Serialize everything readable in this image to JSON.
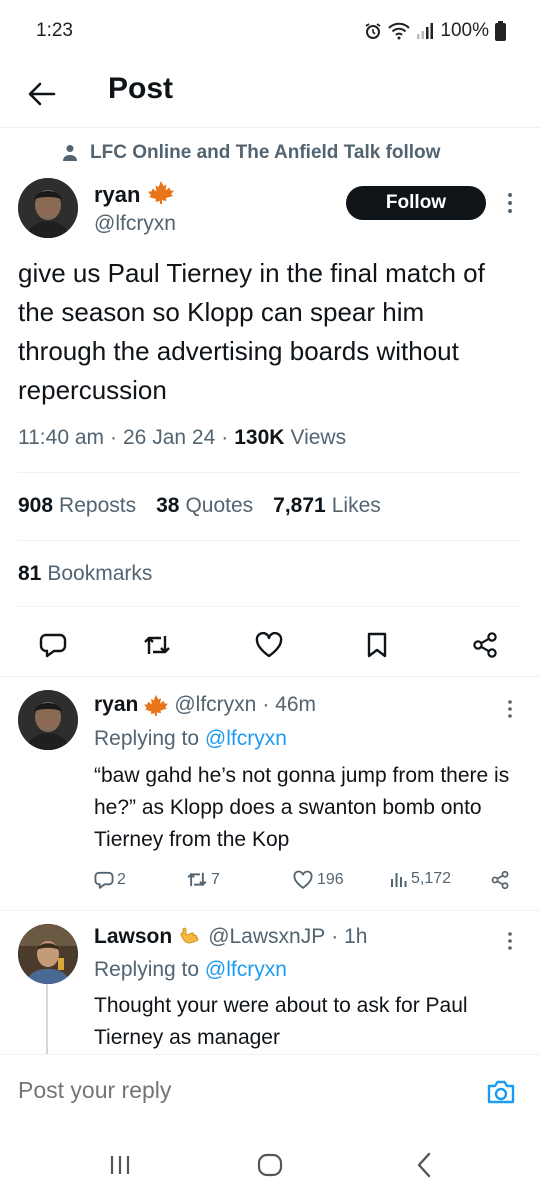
{
  "status_bar": {
    "time": "1:23",
    "battery": "100%"
  },
  "header": {
    "title": "Post"
  },
  "social_context": {
    "text": "LFC Online and The Anfield Talk follow"
  },
  "author": {
    "name": "ryan",
    "handle": "@lfcryxn",
    "badge_emoji": "🍁"
  },
  "follow_button": {
    "label": "Follow"
  },
  "post": {
    "text": "give us Paul Tierney in the final match of the season so Klopp can spear him through the advertising boards without repercussion",
    "time": "11:40 am",
    "date": "26 Jan 24",
    "views_count": "130K",
    "views_label": "Views",
    "separator": "·"
  },
  "stats": {
    "reposts_count": "908",
    "reposts_label": "Reposts",
    "quotes_count": "38",
    "quotes_label": "Quotes",
    "likes_count": "7,871",
    "likes_label": "Likes",
    "bookmarks_count": "81",
    "bookmarks_label": "Bookmarks"
  },
  "action_icons": [
    "reply-icon",
    "repost-icon",
    "like-icon",
    "bookmark-icon",
    "share-icon"
  ],
  "replies": [
    {
      "name": "ryan",
      "badge_emoji": "🍁",
      "handle": "@lfcryxn",
      "time": "· 46m",
      "replying_prefix": "Replying to",
      "replying_handle": "@lfcryxn",
      "text": "“baw gahd he’s not gonna jump from there is he?” as Klopp does a swanton bomb onto Tierney from the Kop",
      "replies_count": "2",
      "reposts_count": "7",
      "likes_count": "196",
      "views_count": "5,172"
    },
    {
      "name": "Lawson",
      "badge_emoji": "🤙",
      "handle": "@LawsxnJP",
      "time": "· 1h",
      "replying_prefix": "Replying to",
      "replying_handle": "@lfcryxn",
      "text": "Thought your were about to ask for Paul Tierney as manager"
    }
  ],
  "composer": {
    "placeholder": "Post your reply"
  },
  "colors": {
    "text": "#0f1419",
    "secondary": "#536471",
    "accent": "#1d9bf0",
    "divider": "#eff3f4",
    "like_leaf": "#e8741c"
  }
}
